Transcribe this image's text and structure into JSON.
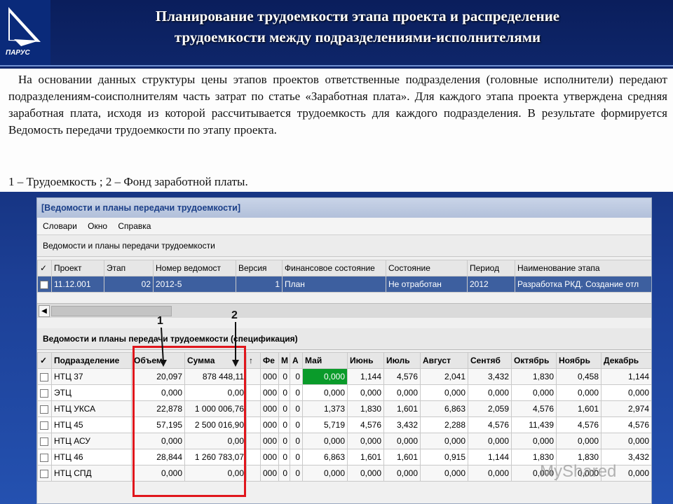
{
  "title_line1": "Планирование трудоемкости этапа проекта и распределение",
  "title_line2": "трудоемкости между подразделениями-исполнителями",
  "logo_text": "ПАРУС",
  "paragraph": "На основании данных структуры цены этапов проектов ответственные подразделения (головные исполнители) передают подразделениям-соисполнителям часть затрат по статье «Заработная плата». Для каждого этапа проекта утверждена средняя заработная плата, исходя из которой рассчитывается трудоемкость для каждого подразделения. В результате формируется Ведомость передачи трудоемкости по этапу проекта.",
  "legend": "1 – Трудоемкость ; 2 – Фонд заработной платы.",
  "window": {
    "title": "[Ведомости и планы передачи трудоемкости]",
    "menu": [
      "Словари",
      "Окно",
      "Справка"
    ],
    "section1": "Ведомости и планы передачи трудоемкости",
    "section2": "Ведомости и планы передачи трудоемкости (спецификация)"
  },
  "table1": {
    "headers": [
      "✓",
      "Проект",
      "Этап",
      "Номер ведомост",
      "Версия",
      "Финансовое состояние",
      "Состояние",
      "Период",
      "Наименование этапа"
    ],
    "row": [
      "11.12.001",
      "02",
      "2012-5",
      "1",
      "План",
      "Не отработан",
      "2012",
      "Разработка РКД. Создание отл"
    ]
  },
  "table2": {
    "headers": [
      "✓",
      "Подразделение",
      "Объем",
      "Сумма",
      "↑",
      "Фе",
      "М",
      "А",
      "Май",
      "Июнь",
      "Июль",
      "Август",
      "Сентяб",
      "Октябрь",
      "Ноябрь",
      "Декабрь"
    ],
    "rows": [
      [
        "НТЦ 37",
        "20,097",
        "878 448,11",
        "",
        "000",
        "0",
        "0",
        "0,000",
        "1,144",
        "4,576",
        "2,041",
        "3,432",
        "1,830",
        "0,458",
        "1,144"
      ],
      [
        "ЭТЦ",
        "0,000",
        "0,00",
        "",
        "000",
        "0",
        "0",
        "0,000",
        "0,000",
        "0,000",
        "0,000",
        "0,000",
        "0,000",
        "0,000",
        "0,000"
      ],
      [
        "НТЦ УКСА",
        "22,878",
        "1 000 006,76",
        "",
        "000",
        "0",
        "0",
        "1,373",
        "1,830",
        "1,601",
        "6,863",
        "2,059",
        "4,576",
        "1,601",
        "2,974"
      ],
      [
        "НТЦ 45",
        "57,195",
        "2 500 016,90",
        "",
        "000",
        "0",
        "0",
        "5,719",
        "4,576",
        "3,432",
        "2,288",
        "4,576",
        "11,439",
        "4,576",
        "4,576"
      ],
      [
        "НТЦ АСУ",
        "0,000",
        "0,00",
        "",
        "000",
        "0",
        "0",
        "0,000",
        "0,000",
        "0,000",
        "0,000",
        "0,000",
        "0,000",
        "0,000",
        "0,000"
      ],
      [
        "НТЦ 46",
        "28,844",
        "1 260 783,07",
        "",
        "000",
        "0",
        "0",
        "6,863",
        "1,601",
        "1,601",
        "0,915",
        "1,144",
        "1,830",
        "1,830",
        "3,432"
      ],
      [
        "НТЦ СПД",
        "0,000",
        "0,00",
        "",
        "000",
        "0",
        "0",
        "0,000",
        "0,000",
        "0,000",
        "0,000",
        "0,000",
        "0,000",
        "0,000",
        "0,000"
      ]
    ]
  },
  "markers": [
    "1",
    "2"
  ],
  "watermark": "MyShared",
  "colors": {
    "background": "#1c3f95",
    "highlight_red": "#e0161c",
    "selected_cell": "#0a9b2a",
    "selected_row": "#3d5f9f"
  }
}
